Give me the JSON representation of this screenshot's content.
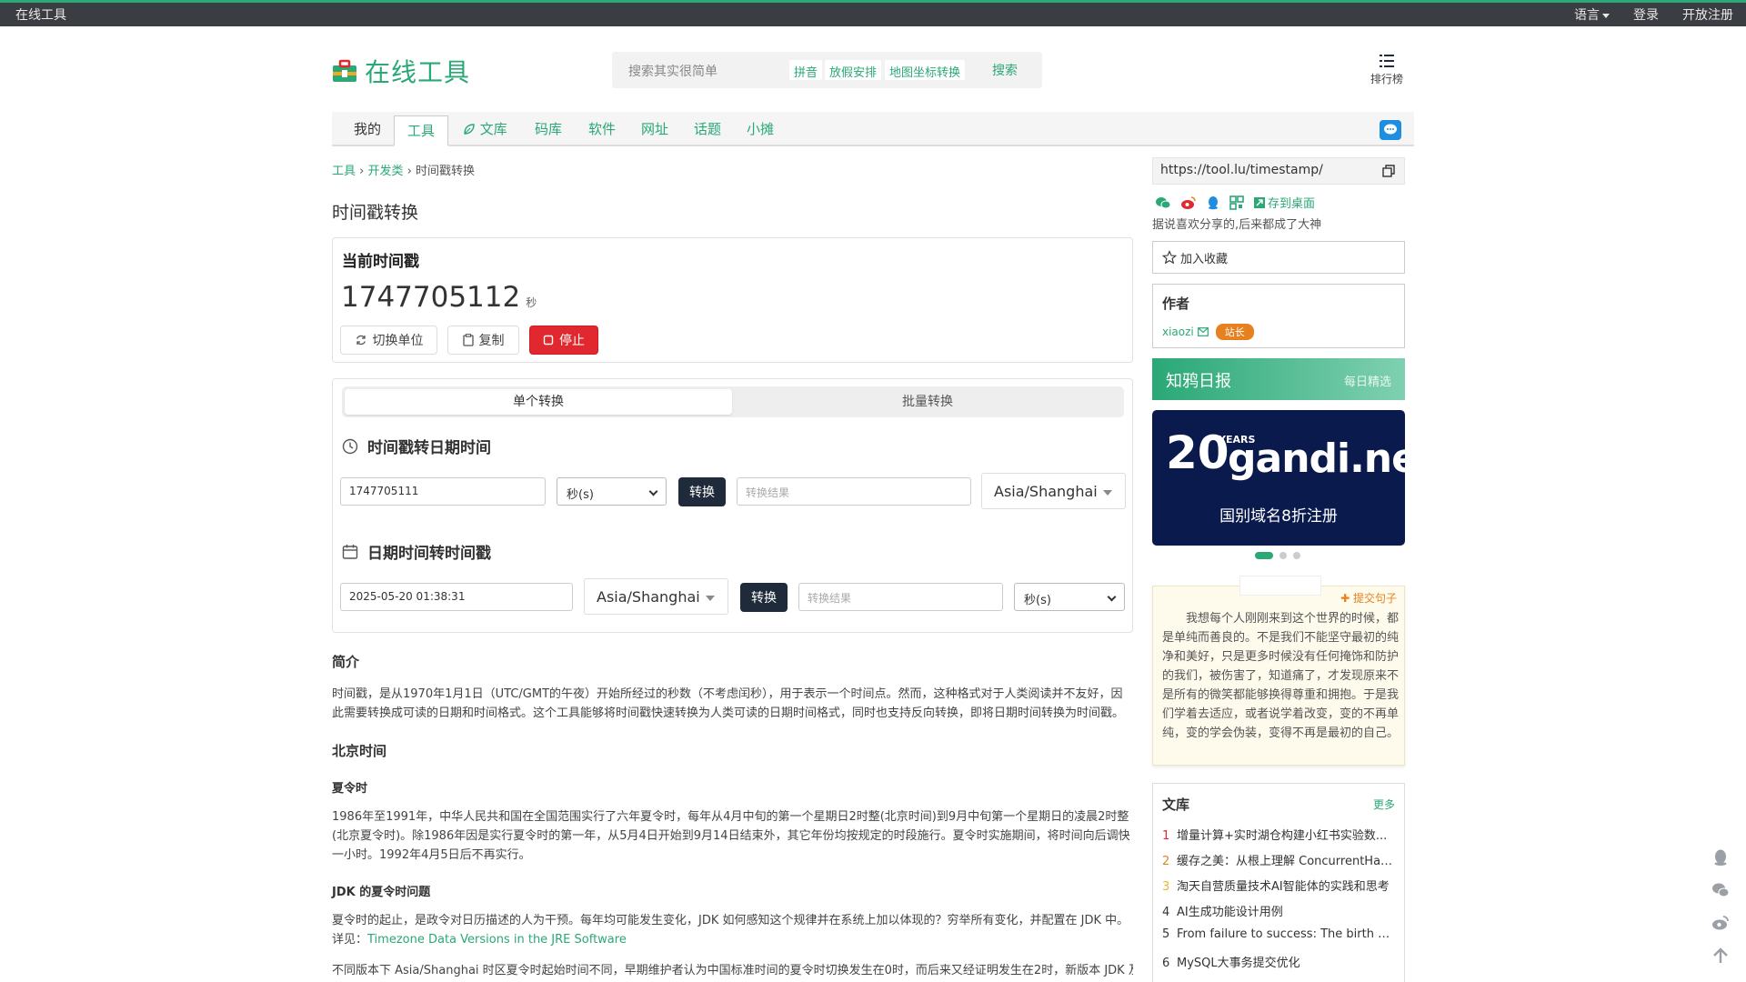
{
  "topbar": {
    "site_name": "在线工具",
    "language": "语言",
    "login": "登录",
    "register": "开放注册"
  },
  "header": {
    "logo_text": "在线工具",
    "search_placeholder": "搜索其实很简单",
    "hot_links": [
      "拼音",
      "放假安排",
      "地图坐标转换"
    ],
    "search_button": "搜索",
    "rank_label": "排行榜"
  },
  "nav": {
    "tabs": [
      "我的",
      "工具",
      "文库",
      "码库",
      "软件",
      "网址",
      "话题",
      "小摊"
    ],
    "active": "工具"
  },
  "breadcrumb": {
    "level1": "工具",
    "level2": "开发类",
    "current": "时间戳转换"
  },
  "page_title": "时间戳转换",
  "current": {
    "title": "当前时间戳",
    "value": "1747705112",
    "unit": "秒",
    "switch_unit": "切换单位",
    "copy": "复制",
    "stop": "停止"
  },
  "converter": {
    "tab_single": "单个转换",
    "tab_batch": "批量转换",
    "ts_to_date": {
      "title": "时间戳转日期时间",
      "input_value": "1747705111",
      "unit": "秒(s)",
      "button": "转换",
      "result_placeholder": "转换结果",
      "timezone": "Asia/Shanghai"
    },
    "date_to_ts": {
      "title": "日期时间转时间戳",
      "input_value": "2025-05-20 01:38:31",
      "timezone": "Asia/Shanghai",
      "button": "转换",
      "result_placeholder": "转换结果",
      "unit": "秒(s)"
    }
  },
  "article": {
    "intro_title": "简介",
    "intro_text": "时间戳，是从1970年1月1日（UTC/GMT的午夜）开始所经过的秒数（不考虑闰秒），用于表示一个时间点。然而，这种格式对于人类阅读并不友好，因此需要转换成可读的日期和时间格式。这个工具能够将时间戳快速转换为人类可读的日期时间格式，同时也支持反向转换，即将日期时间转换为时间戳。",
    "beijing_title": "北京时间",
    "dst_title": "夏令时",
    "dst_text": "1986年至1991年，中华人民共和国在全国范围实行了六年夏令时，每年从4月中旬的第一个星期日2时整(北京时间)到9月中旬第一个星期日的凌晨2时整(北京夏令时)。除1986年因是实行夏令时的第一年，从5月4日开始到9月14日结束外，其它年份均按规定的时段施行。夏令时实施期间，将时间向后调快一小时。1992年4月5日后不再实行。",
    "jdk_title": "JDK 的夏令时问题",
    "jdk_text": "夏令时的起止，是政令对日历描述的人为干预。每年均可能发生变化，JDK 如何感知这个规律并在系统上加以体现的？穷举所有变化，并配置在 JDK 中。详见：",
    "jdk_link": "Timezone Data Versions in the JRE Software",
    "last_text": "不同版本下 Asia/Shanghai 时区夏令时起始时间不同，早期维护者认为中国标准时间的夏令时切换发生在0时，而后来又经证明发生在2时，新版本 JDK 及时"
  },
  "sidebar": {
    "url": "https://tool.lu/timestamp/",
    "save_desktop": "存到桌面",
    "share_tip": "据说喜欢分享的,后来都成了大神",
    "favorite": "加入收藏",
    "author_title": "作者",
    "author_name": "xiaozi",
    "author_badge": "站长",
    "daily_title": "知鸦日报",
    "daily_sub": "每日精选",
    "ad_brand": "gandi.net",
    "ad_years": "YEARS",
    "ad_twenty": "20",
    "ad_sub": "国别域名8折注册",
    "quote_submit": "提交句子",
    "quote_text": "我想每个人刚刚来到这个世界的时候，都是单纯而善良的。不是我们不能坚守最初的纯净和美好，只是更多时候没有任何掩饰和防护的我们，被伤害了，知道痛了，才发现原来不是所有的微笑都能够换得尊重和拥抱。于是我们学着去适应，或者说学着改变，变的不再单纯，变的学会伪装，变得不再是最初的自己。",
    "library_title": "文库",
    "library_more": "更多",
    "library_items": [
      {
        "num": "1",
        "title": "增量计算+实时湖仓构建小红书实验数..."
      },
      {
        "num": "2",
        "title": "缓存之美：从根上理解 ConcurrentHas..."
      },
      {
        "num": "3",
        "title": "淘天自营质量技术AI智能体的实践和思考"
      },
      {
        "num": "4",
        "title": "AI生成功能设计用例"
      },
      {
        "num": "5",
        "title": "From failure to success: The birth of Gr..."
      },
      {
        "num": "6",
        "title": "MySQL大事务提交优化"
      }
    ]
  },
  "colors": {
    "brand_green": "#2aa876",
    "stop_red": "#e0282e",
    "topbar": "#3a3d42",
    "badge_orange": "#e7801e"
  }
}
